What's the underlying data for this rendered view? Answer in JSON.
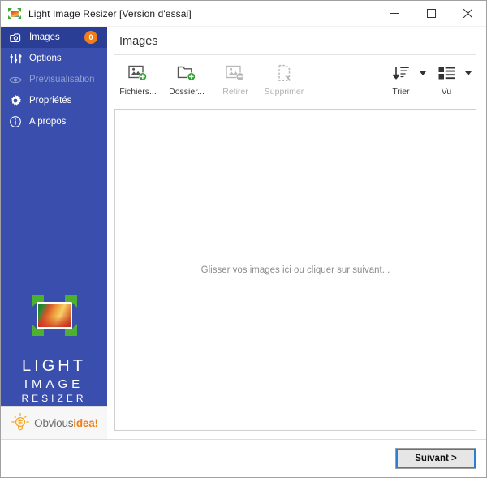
{
  "window": {
    "title": "Light Image Resizer  [Version d'essai]",
    "app_icon": "light-image-resizer-icon",
    "controls": {
      "minimize": "minimize-icon",
      "maximize": "maximize-icon",
      "close": "close-icon"
    }
  },
  "sidebar": {
    "background_color": "#3a4fad",
    "active_color": "#2b3e96",
    "badge_color": "#ef7d1a",
    "items": [
      {
        "label": "Images",
        "icon": "images-icon",
        "active": true,
        "disabled": false,
        "badge": "0"
      },
      {
        "label": "Options",
        "icon": "sliders-icon",
        "active": false,
        "disabled": false,
        "badge": null
      },
      {
        "label": "Prévisualisation",
        "icon": "eye-icon",
        "active": false,
        "disabled": true,
        "badge": null
      },
      {
        "label": "Propriétés",
        "icon": "gear-icon",
        "active": false,
        "disabled": false,
        "badge": null
      },
      {
        "label": "A propos",
        "icon": "info-icon",
        "active": false,
        "disabled": false,
        "badge": null
      }
    ],
    "brand": {
      "line1": "LIGHT",
      "line2": "IMAGE",
      "line3": "RESIZER",
      "logo_icon": "resize-photo-icon"
    },
    "vendor": {
      "icon": "lightbulb-icon",
      "name_part1": "Obvious",
      "name_part2": "idea!",
      "color1": "#6d6e71",
      "color2": "#f07f1a"
    }
  },
  "main": {
    "page_title": "Images",
    "toolbar": {
      "buttons": [
        {
          "label": "Fichiers...",
          "icon": "add-image-icon",
          "disabled": false
        },
        {
          "label": "Dossier...",
          "icon": "add-folder-icon",
          "disabled": false
        },
        {
          "label": "Retirer",
          "icon": "remove-image-icon",
          "disabled": true
        },
        {
          "label": "Supprimer",
          "icon": "delete-file-icon",
          "disabled": true
        }
      ],
      "right_buttons": [
        {
          "label": "Trier",
          "icon": "sort-icon",
          "caret": "chevron-down-icon"
        },
        {
          "label": "Vu",
          "icon": "view-icon",
          "caret": "chevron-down-icon"
        }
      ]
    },
    "drop_area": {
      "message": "Glisser vos images ici ou cliquer sur suivant..."
    }
  },
  "footer": {
    "next_label": "Suivant >",
    "focus_color": "#2a7fd4"
  }
}
